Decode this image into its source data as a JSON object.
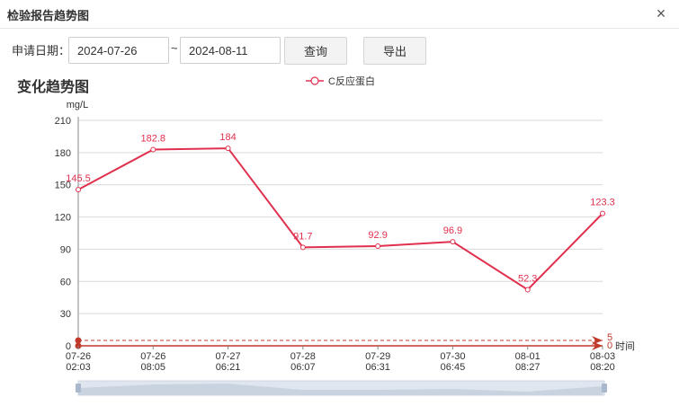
{
  "dialog": {
    "title": "检验报告趋势图",
    "close_glyph": "×"
  },
  "filters": {
    "label": "申请日期：",
    "start_date": "2024-07-26",
    "separator": "~",
    "end_date": "2024-08-11",
    "query_label": "查询",
    "export_label": "导出"
  },
  "colors": {
    "series": "#e0304e",
    "reference": "#c0392b",
    "grid": "#d9d9d9",
    "axis_text": "#333333",
    "zoom_fill": "#dfe6ef",
    "zoom_handle": "#a9b8cc"
  },
  "chart_data": {
    "type": "line",
    "title": "变化趋势图",
    "ylabel": "mg/L",
    "xlabel": "时间",
    "ylim": [
      0,
      210
    ],
    "yticks": [
      0,
      30,
      60,
      90,
      120,
      150,
      180,
      210
    ],
    "grid": true,
    "legend_position": "top-center",
    "categories": [
      [
        "07-26",
        "02:03"
      ],
      [
        "07-26",
        "08:05"
      ],
      [
        "07-27",
        "06:21"
      ],
      [
        "07-28",
        "06:07"
      ],
      [
        "07-29",
        "06:31"
      ],
      [
        "07-30",
        "06:45"
      ],
      [
        "08-01",
        "08:27"
      ],
      [
        "08-03",
        "08:20"
      ]
    ],
    "series": [
      {
        "name": "C反应蛋白",
        "values": [
          145.5,
          182.8,
          184,
          91.7,
          92.9,
          96.9,
          52.3,
          123.3
        ]
      }
    ],
    "reference_lines": [
      {
        "value": 5,
        "label": "5"
      },
      {
        "value": 0,
        "label": "0"
      }
    ]
  }
}
